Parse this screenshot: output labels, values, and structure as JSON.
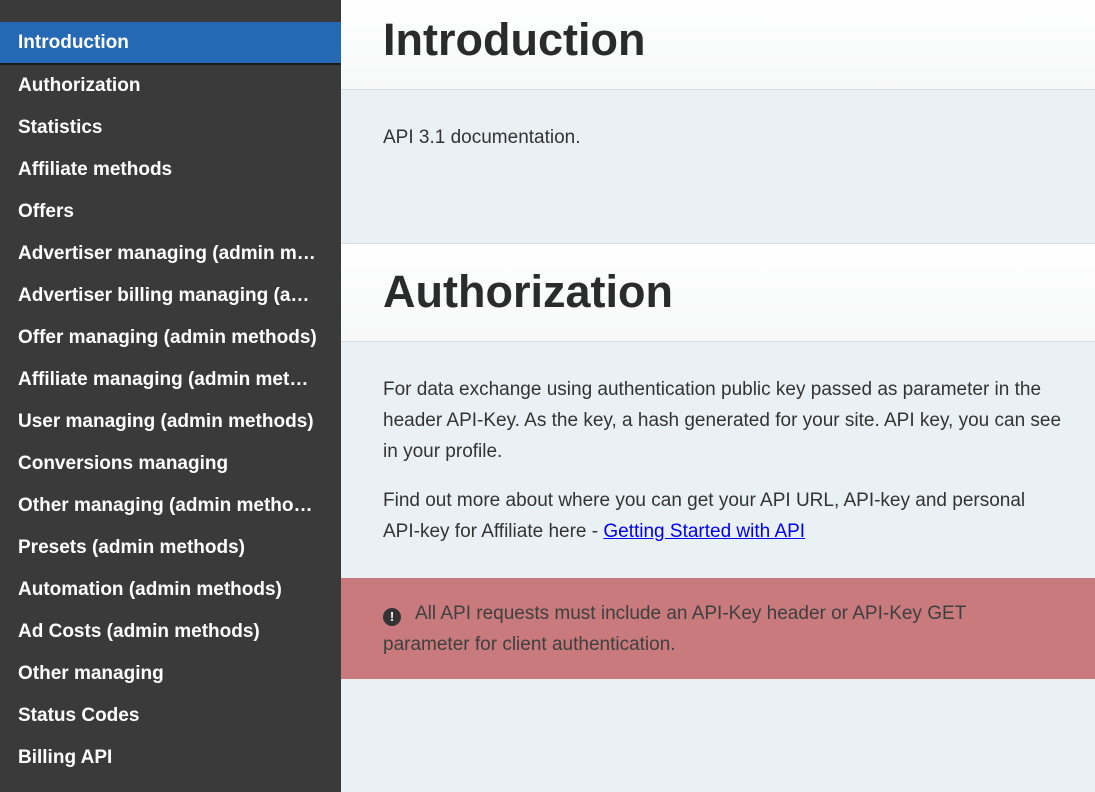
{
  "sidebar": {
    "items": [
      {
        "label": "Introduction",
        "active": true
      },
      {
        "label": "Authorization"
      },
      {
        "label": "Statistics"
      },
      {
        "label": "Affiliate methods"
      },
      {
        "label": "Offers"
      },
      {
        "label": "Advertiser managing (admin methods)"
      },
      {
        "label": "Advertiser billing managing (admin methods)"
      },
      {
        "label": "Offer managing (admin methods)"
      },
      {
        "label": "Affiliate managing (admin methods)"
      },
      {
        "label": "User managing (admin methods)"
      },
      {
        "label": "Conversions managing"
      },
      {
        "label": "Other managing (admin methods)"
      },
      {
        "label": "Presets (admin methods)"
      },
      {
        "label": "Automation (admin methods)"
      },
      {
        "label": "Ad Costs (admin methods)"
      },
      {
        "label": "Other managing"
      },
      {
        "label": "Status Codes"
      },
      {
        "label": "Billing API"
      }
    ]
  },
  "introduction": {
    "title": "Introduction",
    "text": "API 3.1 documentation."
  },
  "authorization": {
    "title": "Authorization",
    "paragraph1": "For data exchange using authentication public key passed as parameter in the header API-Key. As the key, a hash generated for your site. API key, you can see in your profile.",
    "paragraph2_prefix": "Find out more about where you can get your API URL, API-key and personal API-key for Affiliate here - ",
    "paragraph2_link": "Getting Started with API",
    "alert_text": "All API requests must include an API-Key header or API-Key GET parameter for client authentication.",
    "alert_icon": "exclamation-circle-icon"
  },
  "colors": {
    "sidebar_bg": "#3a3a3a",
    "active_item": "#2569b5",
    "main_bg": "#eaf1f4",
    "alert_bg": "#c97a7d",
    "link": "#0000ee"
  }
}
